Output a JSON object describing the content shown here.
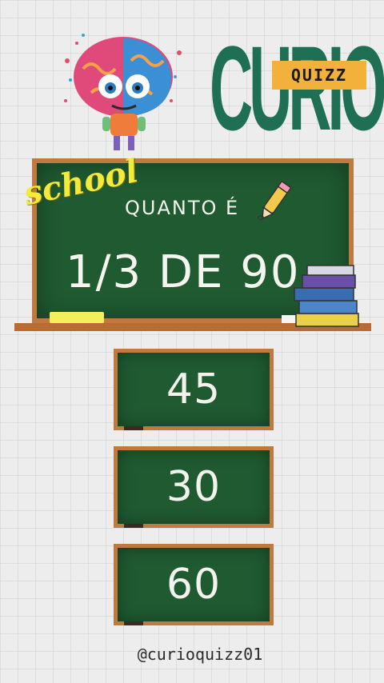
{
  "logo": {
    "brand": "CURIO",
    "badge": "QUIZZ"
  },
  "tag": "school",
  "question": {
    "label": "QUANTO É",
    "text": "1/3 DE 90"
  },
  "answers": [
    "45",
    "30",
    "60"
  ],
  "footer": {
    "handle": "@curioquizz01"
  },
  "colors": {
    "chalkboard": "#1f5a31",
    "frame": "#c07a3f",
    "brand": "#1f6f55",
    "badge": "#f2b13a",
    "chalk": "#f2ef5a"
  },
  "icons": [
    "brain-mascot-icon",
    "pencil-icon",
    "books-icon"
  ]
}
